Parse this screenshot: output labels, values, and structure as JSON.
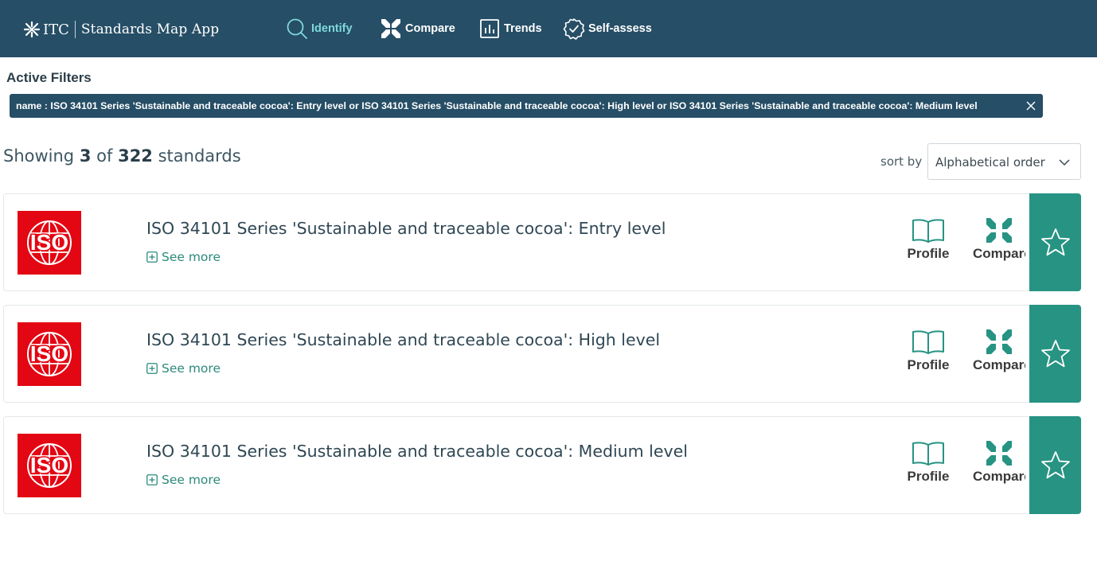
{
  "header": {
    "brand_short": "ITC",
    "app_name": "Standards Map App",
    "nav": [
      {
        "label": "Identify",
        "icon": "search-icon",
        "active": true
      },
      {
        "label": "Compare",
        "icon": "compare-arrows-icon",
        "active": false
      },
      {
        "label": "Trends",
        "icon": "bar-chart-icon",
        "active": false
      },
      {
        "label": "Self-assess",
        "icon": "check-badge-icon",
        "active": false
      }
    ]
  },
  "filters": {
    "title": "Active Filters",
    "chip": "name : ISO 34101 Series 'Sustainable and traceable cocoa': Entry level or ISO 34101 Series 'Sustainable and traceable cocoa': High level or ISO 34101 Series 'Sustainable and traceable cocoa': Medium level"
  },
  "results": {
    "prefix": "Showing",
    "shown": "3",
    "of": "of",
    "total": "322",
    "suffix": "standards"
  },
  "sort": {
    "label": "sort by",
    "value": "Alphabetical order"
  },
  "cards": [
    {
      "title": "ISO 34101 Series 'Sustainable and traceable cocoa': Entry level",
      "logo_text": "ISO",
      "see_more": "See more",
      "profile": "Profile",
      "compare": "Compare"
    },
    {
      "title": "ISO 34101 Series 'Sustainable and traceable cocoa': High level",
      "logo_text": "ISO",
      "see_more": "See more",
      "profile": "Profile",
      "compare": "Compare"
    },
    {
      "title": "ISO 34101 Series 'Sustainable and traceable cocoa': Medium level",
      "logo_text": "ISO",
      "see_more": "See more",
      "profile": "Profile",
      "compare": "Compare"
    }
  ],
  "colors": {
    "header_bg": "#264e66",
    "active_nav": "#7fd8de",
    "accent_teal": "#279383",
    "iso_red": "#e30613"
  }
}
